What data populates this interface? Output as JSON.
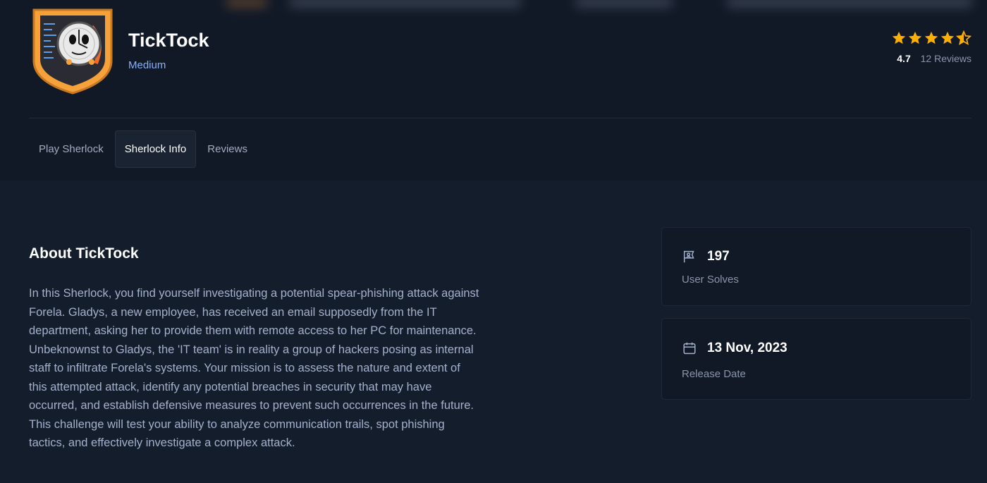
{
  "header": {
    "title": "TickTock",
    "difficulty": "Medium",
    "rating": {
      "value": "4.7",
      "reviews_label": "12 Reviews",
      "stars": 4.5,
      "star_color": "#ffaf00"
    }
  },
  "tabs": [
    {
      "label": "Play Sherlock",
      "active": false
    },
    {
      "label": "Sherlock Info",
      "active": true
    },
    {
      "label": "Reviews",
      "active": false
    }
  ],
  "about": {
    "heading": "About TickTock",
    "text": "In this Sherlock, you find yourself investigating a potential spear-phishing attack against Forela. Gladys, a new employee, has received an email supposedly from the IT department, asking her to provide them with remote access to her PC for maintenance. Unbeknownst to Gladys, the 'IT team' is in reality a group of hackers posing as internal staff to infiltrate Forela's systems. Your mission is to assess the nature and extent of this attempted attack, identify any potential breaches in security that may have occurred, and establish defensive measures to prevent such occurrences in the future. This challenge will test your ability to analyze communication trails, spot phishing tactics, and effectively investigate a complex attack."
  },
  "stats": {
    "solves": {
      "value": "197",
      "label": "User Solves",
      "icon": "user-flag-icon"
    },
    "release": {
      "value": "13 Nov, 2023",
      "label": "Release Date",
      "icon": "calendar-icon"
    }
  },
  "colors": {
    "background": "#141d2b",
    "header_background": "#111927",
    "accent_blue": "#8ab0f5",
    "logo_orange": "#f7a13b"
  }
}
